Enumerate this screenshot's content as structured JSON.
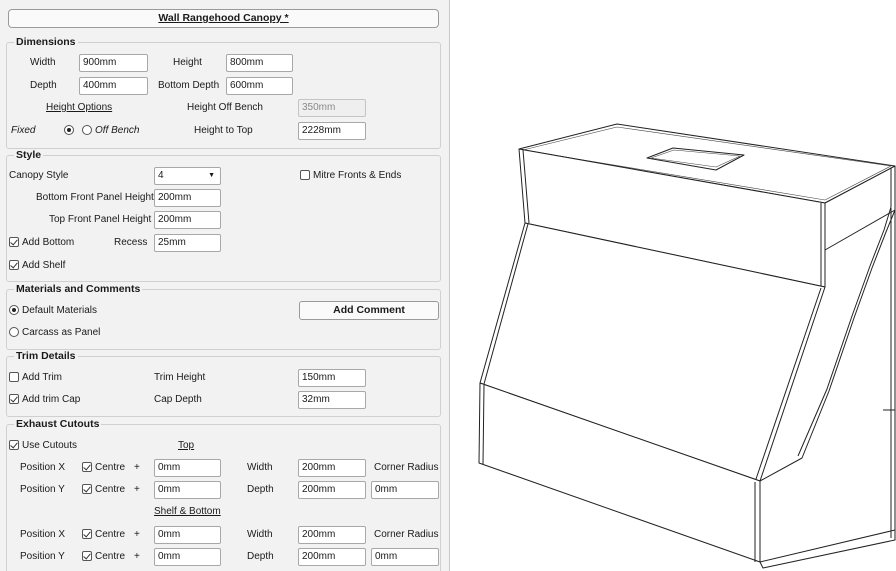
{
  "title": "Wall Rangehood Canopy *",
  "dimensions": {
    "heading": "Dimensions",
    "width_label": "Width",
    "width_value": "900mm",
    "height_label": "Height",
    "height_value": "800mm",
    "depth_label": "Depth",
    "depth_value": "400mm",
    "bottom_depth_label": "Bottom Depth",
    "bottom_depth_value": "600mm",
    "height_options_label": "Height Options",
    "height_off_bench_label": "Height Off Bench",
    "height_off_bench_value": "350mm",
    "fixed_label": "Fixed",
    "off_bench_label": "Off Bench",
    "height_to_top_label": "Height to Top",
    "height_to_top_value": "2228mm"
  },
  "style": {
    "heading": "Style",
    "canopy_style_label": "Canopy Style",
    "canopy_style_value": "4",
    "mitre_label": "Mitre Fronts & Ends",
    "bottom_front_label": "Bottom Front Panel Height",
    "bottom_front_value": "200mm",
    "top_front_label": "Top Front Panel Height",
    "top_front_value": "200mm",
    "add_bottom_label": "Add Bottom",
    "recess_label": "Recess",
    "recess_value": "25mm",
    "add_shelf_label": "Add Shelf"
  },
  "materials": {
    "heading": "Materials and Comments",
    "default_label": "Default Materials",
    "carcass_label": "Carcass as Panel",
    "add_comment_label": "Add Comment"
  },
  "trim": {
    "heading": "Trim Details",
    "add_trim_label": "Add Trim",
    "trim_height_label": "Trim Height",
    "trim_height_value": "150mm",
    "add_trim_cap_label": "Add trim Cap",
    "cap_depth_label": "Cap Depth",
    "cap_depth_value": "32mm"
  },
  "exhaust": {
    "heading": "Exhaust Cutouts",
    "use_cutouts_label": "Use Cutouts",
    "top_label": "Top",
    "shelf_bottom_label": "Shelf & Bottom",
    "pos_x_label": "Position X",
    "pos_y_label": "Position Y",
    "centre_label": "Centre",
    "plus": "+",
    "width_label": "Width",
    "depth_label": "Depth",
    "corner_radius_label": "Corner Radius",
    "top_pos_x": "0mm",
    "top_pos_y": "0mm",
    "top_width": "200mm",
    "top_depth": "200mm",
    "top_corner_radius": "0mm",
    "sb_pos_x": "0mm",
    "sb_pos_y": "0mm",
    "sb_width": "200mm",
    "sb_depth": "200mm",
    "sb_corner_radius": "0mm"
  }
}
